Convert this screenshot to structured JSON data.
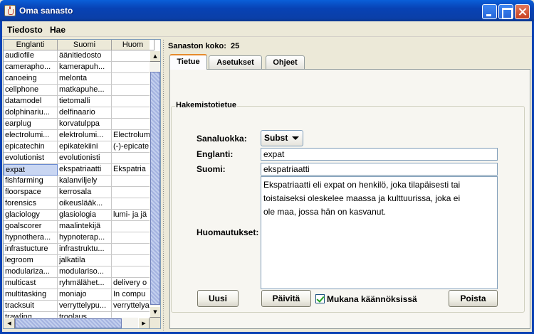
{
  "window": {
    "title": "Oma sanasto"
  },
  "menu": [
    "Tiedosto",
    "Hae"
  ],
  "table": {
    "columns": [
      "Englanti",
      "Suomi",
      "Huom"
    ],
    "rows": [
      [
        "audiofile",
        "äänitiedosto",
        ""
      ],
      [
        "cameraphо...",
        "kamerapuh...",
        ""
      ],
      [
        "canoeing",
        "melonta",
        ""
      ],
      [
        "cellphone",
        "matkapuhe...",
        ""
      ],
      [
        "datamodel",
        "tietomalli",
        ""
      ],
      [
        "dolphinariu...",
        "delfinaario",
        ""
      ],
      [
        "earplug",
        "korvatulppa",
        ""
      ],
      [
        "electrolumi...",
        "elektrolumi...",
        "Electrolum"
      ],
      [
        "epicatechin",
        "epikatekiini",
        "(-)-epicate"
      ],
      [
        "evolutionist",
        "evolutionisti",
        ""
      ],
      [
        "expat",
        "ekspatriaatti",
        "Ekspatria"
      ],
      [
        "fishfarming",
        "kalanviljely",
        ""
      ],
      [
        "floorspace",
        "kerrosala",
        ""
      ],
      [
        "forensics",
        "oikeuslääk...",
        ""
      ],
      [
        "glaciology",
        "glasiologia",
        "lumi- ja jä"
      ],
      [
        "goalscorer",
        "maalintekijä",
        ""
      ],
      [
        "hypnothera...",
        "hypnoterap...",
        ""
      ],
      [
        "infrastucture",
        "infrastruktu...",
        ""
      ],
      [
        "legroom",
        "jalkatila",
        ""
      ],
      [
        "modulariza...",
        "modulariso...",
        ""
      ],
      [
        "multicast",
        "ryhmälähet...",
        "delivery o"
      ],
      [
        "multitasking",
        "moniajo",
        "In compu"
      ],
      [
        "tracksuit",
        "verryttelypu...",
        "verryttelya"
      ],
      [
        "trawling",
        "troolaus",
        ""
      ]
    ],
    "selected_index": 10
  },
  "status": {
    "label": "Sanaston koko:",
    "value": "25"
  },
  "tabs": [
    "Tietue",
    "Asetukset",
    "Ohjeet"
  ],
  "record": {
    "group_title": "Hakemistotietue",
    "word_class_label": "Sanaluokka:",
    "word_class_value": "Subst",
    "english_label": "Englanti:",
    "english_value": "expat",
    "finnish_label": "Suomi:",
    "finnish_value": "ekspatriaatti",
    "notes_label": "Huomautukset:",
    "notes_value": "Ekspatriaatti eli expat on henkilö, joka tilapäisesti tai\ntoistaiseksi oleskelee maassa ja kulttuurissa, joka ei\nole maa, jossa hän on kasvanut."
  },
  "buttons": {
    "new": "Uusi",
    "update": "Päivitä",
    "include_label": "Mukana käännöksissä",
    "delete": "Poista"
  }
}
